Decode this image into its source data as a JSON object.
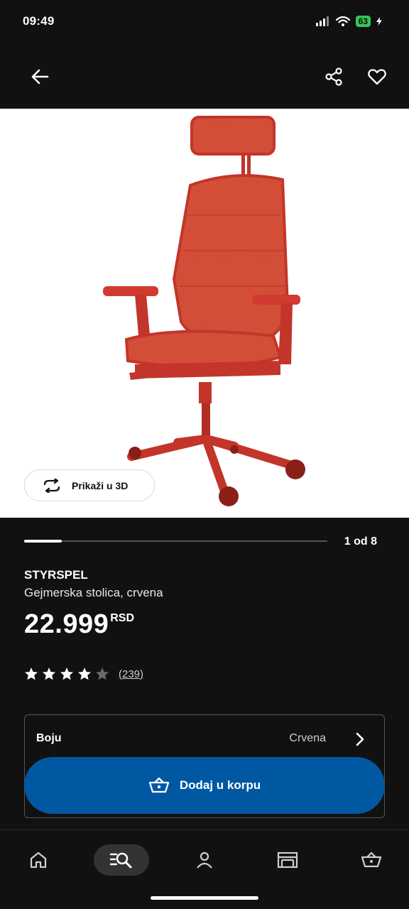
{
  "status": {
    "time": "09:49",
    "battery": "63"
  },
  "product": {
    "name": "STYRSPEL",
    "description": "Gejmerska stolica, crvena",
    "price": "22.999",
    "currency": "RSD",
    "rating": 4,
    "rating_max": 5,
    "reviews": "(239)"
  },
  "gallery": {
    "view3d_label": "Prikaži u 3D",
    "pager_text": "1 od 8",
    "current_image": 1,
    "total_images": 8
  },
  "color_option": {
    "label": "Boju",
    "value": "Crvena"
  },
  "cart": {
    "label": "Dodaj u korpu"
  },
  "icons": {
    "back": "arrow-left-icon",
    "share": "share-icon",
    "favorite": "heart-icon",
    "rotate": "rotate-3d-icon",
    "basket": "basket-icon",
    "home": "home-icon",
    "search": "search-list-icon",
    "profile": "person-icon",
    "store": "store-icon",
    "cart": "cart-icon"
  },
  "colors": {
    "background": "#111111",
    "accent": "#0058a3",
    "chair": "#d33a2f"
  }
}
